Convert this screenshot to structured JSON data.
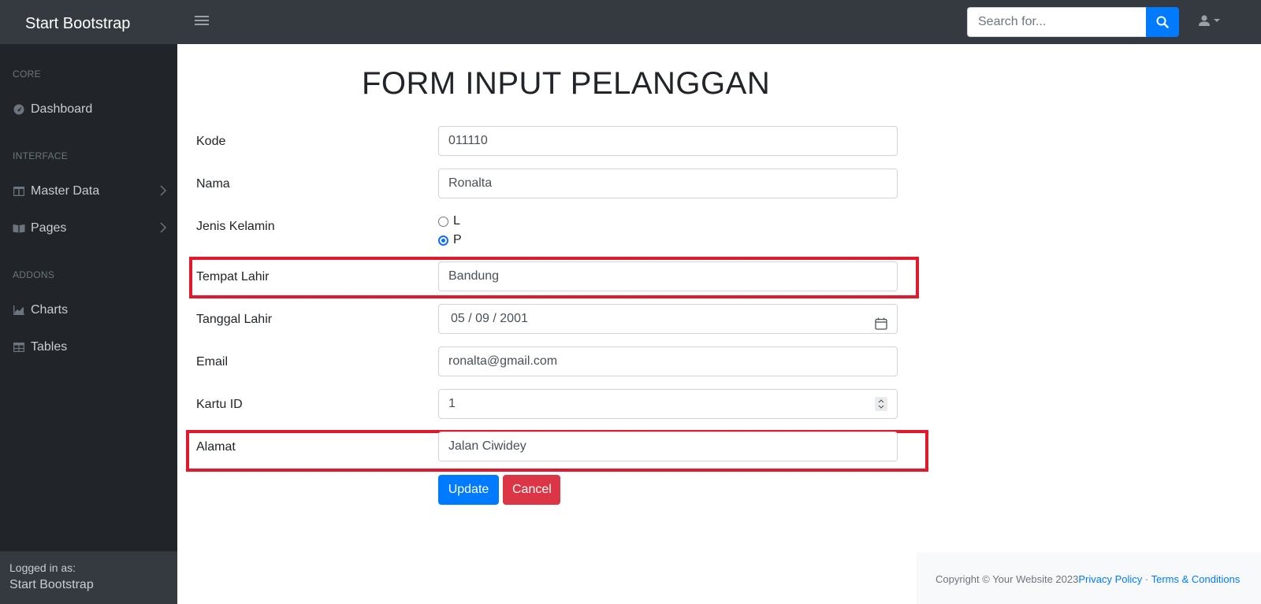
{
  "navbar": {
    "brand": "Start Bootstrap",
    "search_placeholder": "Search for..."
  },
  "sidebar": {
    "sections": [
      {
        "heading": "CORE",
        "items": [
          {
            "label": "Dashboard",
            "icon": "tachometer-icon"
          }
        ]
      },
      {
        "heading": "INTERFACE",
        "items": [
          {
            "label": "Master Data",
            "icon": "columns-icon"
          },
          {
            "label": "Pages",
            "icon": "book-open-icon"
          }
        ]
      },
      {
        "heading": "ADDONS",
        "items": [
          {
            "label": "Charts",
            "icon": "chart-area-icon"
          },
          {
            "label": "Tables",
            "icon": "table-icon"
          }
        ]
      }
    ],
    "footer_small": "Logged in as:",
    "footer_name": "Start Bootstrap"
  },
  "form": {
    "title": "FORM INPUT PELANGGAN",
    "kode_label": "Kode",
    "kode_value": "011110",
    "nama_label": "Nama",
    "nama_value": "Ronalta",
    "jk_label": "Jenis Kelamin",
    "jk_options": [
      "L",
      "P"
    ],
    "jk_selected": "P",
    "tempat_label": "Tempat Lahir",
    "tempat_value": "Bandung",
    "tanggal_label": "Tanggal Lahir",
    "tanggal_value": "05 / 09 / 2001",
    "email_label": "Email",
    "email_value": "ronalta@gmail.com",
    "kartu_label": "Kartu ID",
    "kartu_value": "1",
    "alamat_label": "Alamat",
    "alamat_value": "Jalan Ciwidey",
    "update_label": "Update",
    "cancel_label": "Cancel"
  },
  "footer": {
    "copyright": "Copyright © Your Website 2023",
    "privacy": "Privacy Policy",
    "separator": "·",
    "terms": "Terms & Conditions"
  },
  "colors": {
    "navbar_bg": "#343a40",
    "sidebar_bg": "#212529",
    "primary": "#007bff",
    "danger": "#dc3545",
    "highlight": "#e0192c"
  }
}
